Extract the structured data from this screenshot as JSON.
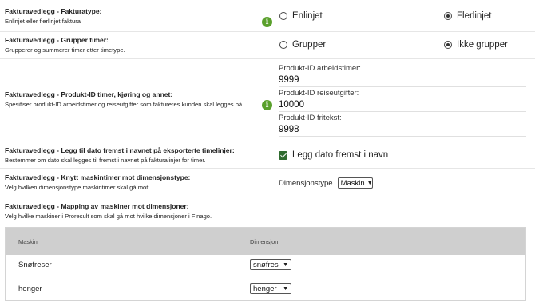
{
  "settings": [
    {
      "title": "Fakturavedlegg - Fakturatype:",
      "description": "Enlinjet eller flerlinjet faktura",
      "option_a": "Enlinjet",
      "option_b": "Flerlinjet",
      "selected": "Flerlinjet"
    },
    {
      "title": "Fakturavedlegg - Grupper timer:",
      "description": "Grupperer og summerer timer etter timetype.",
      "option_a": "Grupper",
      "option_b": "Ikke grupper",
      "selected": "Ikke grupper"
    },
    {
      "title": "Fakturavedlegg - Produkt-ID timer, kjøring og annet:",
      "description": "Spesifiser produkt-ID arbeidstimer og reiseutgifter som faktureres kunden skal legges på.",
      "fields": [
        {
          "label": "Produkt-ID arbeidstimer:",
          "value": "9999"
        },
        {
          "label": "Produkt-ID reiseutgifter:",
          "value": "10000"
        },
        {
          "label": "Produkt-ID fritekst:",
          "value": "9998"
        }
      ]
    },
    {
      "title": "Fakturavedlegg - Legg til dato fremst i navnet på eksporterte timelinjer:",
      "description": "Bestemmer om dato skal legges til fremst i navnet på fakturalinjer for timer.",
      "checkbox_label": "Legg dato fremst i navn",
      "checked": true
    },
    {
      "title": "Fakturavedlegg - Knytt maskintimer mot dimensjonstype:",
      "description": "Velg hvilken dimensjonstype maskintimer skal gå mot.",
      "select_label": "Dimensjonstype",
      "select_value": "Maskin"
    },
    {
      "title": "Fakturavedlegg - Mapping av maskiner mot dimensjoner:",
      "description": "Velg hvilke maskiner i Proresult som skal gå mot hvilke dimensjoner i Finago."
    }
  ],
  "table": {
    "columns": [
      "Maskin",
      "Dimensjon"
    ],
    "rows": [
      {
        "machine": "Snøfreser",
        "dimension": "snøfres"
      },
      {
        "machine": "henger",
        "dimension": "henger"
      }
    ]
  },
  "icons": {
    "info": "info-icon",
    "info_color": "#5aa02c",
    "check_color": "#2f6b2f"
  }
}
